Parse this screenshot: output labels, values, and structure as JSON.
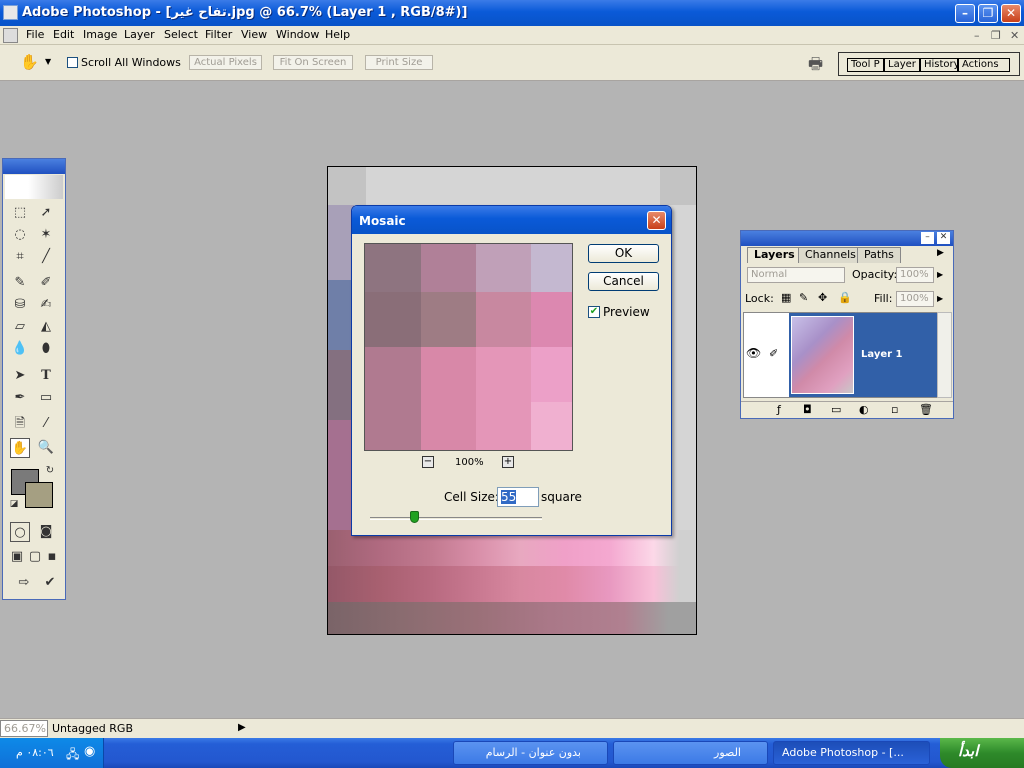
{
  "window": {
    "title": "Adobe Photoshop - [تفاح غير.jpg @ 66.7% (Layer 1 , RGB/8#)]"
  },
  "menu": [
    "File",
    "Edit",
    "Image",
    "Layer",
    "Select",
    "Filter",
    "View",
    "Window",
    "Help"
  ],
  "options": {
    "scroll_all_windows": "Scroll All Windows",
    "actual_pixels": "Actual Pixels",
    "fit_on_screen": "Fit On Screen",
    "print_size": "Print Size",
    "palette_tabs": [
      "Tool P",
      "Layer (",
      "History",
      "Actions"
    ]
  },
  "mosaic": {
    "title": "Mosaic",
    "ok": "OK",
    "cancel": "Cancel",
    "preview_label": "Preview",
    "preview_checked": true,
    "zoom": "100%",
    "cell_size_label": "Cell Size:",
    "cell_size_value": "55",
    "cell_size_unit": "square",
    "zoom_minus": "−",
    "zoom_plus": "+"
  },
  "layers": {
    "tabs": [
      "Layers",
      "Channels",
      "Paths"
    ],
    "blend_mode": "Normal",
    "opacity_label": "Opacity:",
    "opacity_value": "100%",
    "lock_label": "Lock:",
    "fill_label": "Fill:",
    "fill_value": "100%",
    "layer_name": "Layer 1"
  },
  "status": {
    "zoom": "66.67%",
    "profile": "Untagged RGB"
  },
  "taskbar": {
    "start": "ابدأ",
    "time": "٠٨:٠٦ م",
    "tasks": [
      "Adobe Photoshop - [...",
      "الصور",
      "بدون عنوان - الرسام"
    ]
  },
  "colors": {
    "foreground": "#7a7a7a",
    "background": "#a59f82",
    "accent": "#0a5ad8"
  },
  "icons": [
    "hand-icon",
    "zoom-icon",
    "marquee-icon",
    "move-icon",
    "lasso-icon",
    "magic-wand-icon",
    "crop-icon",
    "slice-icon",
    "brush-icon",
    "stamp-icon",
    "eraser-icon",
    "bucket-icon",
    "blur-icon",
    "path-select-icon",
    "type-icon",
    "pen-icon",
    "shape-icon",
    "notes-icon",
    "eyedropper-icon",
    "printer-icon",
    "eye-icon"
  ]
}
